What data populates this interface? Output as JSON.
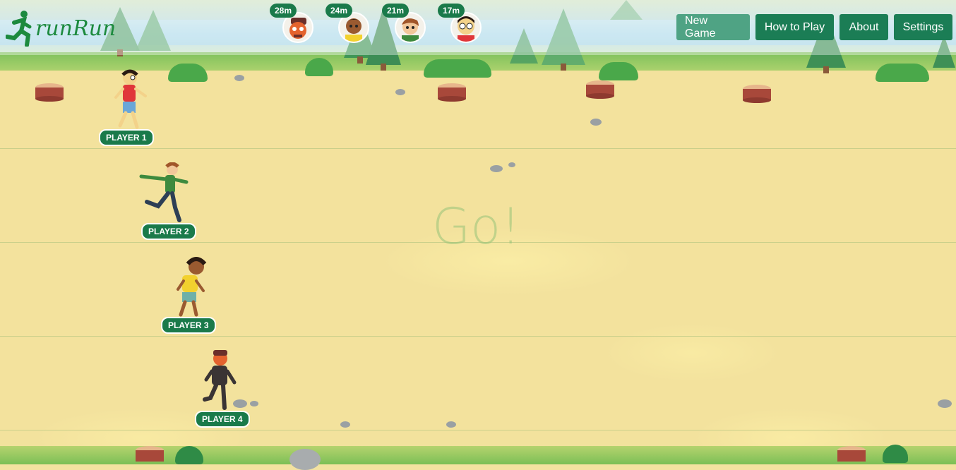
{
  "app": {
    "name": "runRun"
  },
  "header": {
    "players": [
      {
        "distance": "28m",
        "avatar": "player4-face"
      },
      {
        "distance": "24m",
        "avatar": "player3-face"
      },
      {
        "distance": "21m",
        "avatar": "player2-face"
      },
      {
        "distance": "17m",
        "avatar": "player1-face"
      }
    ],
    "buttons": {
      "new_game": "New Game",
      "how_to_play": "How to Play",
      "about": "About",
      "settings": "Settings"
    }
  },
  "game": {
    "status": "Go!",
    "lanes": [
      {
        "label": "PLAYER 1"
      },
      {
        "label": "PLAYER 2"
      },
      {
        "label": "PLAYER 3"
      },
      {
        "label": "PLAYER 4"
      }
    ]
  },
  "colors": {
    "accent": "#1b7d55",
    "logo": "#1c8a3e",
    "track": "#f3e29d"
  }
}
